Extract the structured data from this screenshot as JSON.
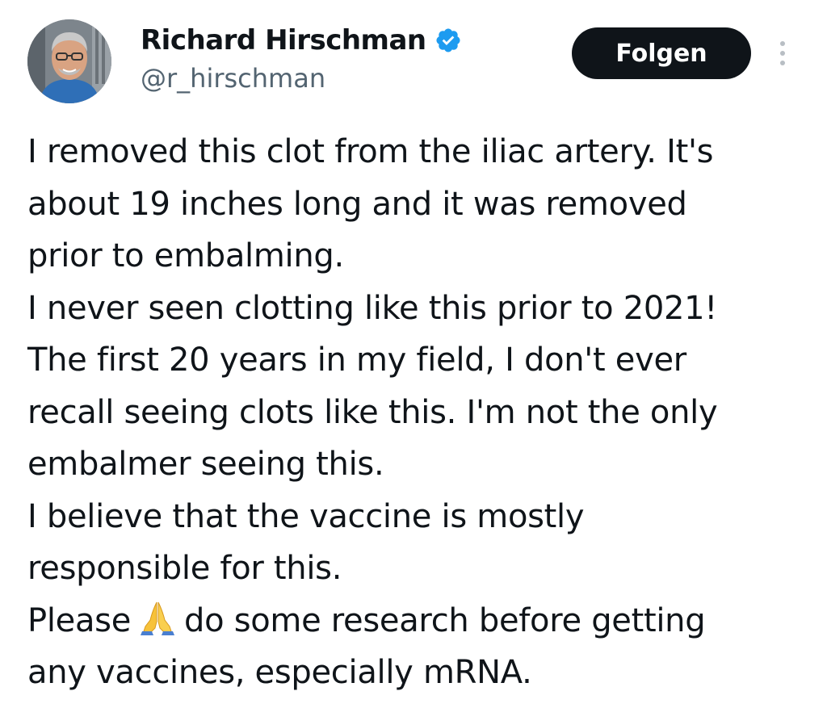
{
  "author": {
    "display_name": "Richard Hirschman",
    "handle": "@r_hirschman",
    "verified": true,
    "verified_color": "#1d9bf0"
  },
  "actions": {
    "follow_label": "Folgen",
    "more_icon": "more-vertical-icon"
  },
  "tweet": {
    "lines": [
      "I removed this clot from the iliac artery. It's",
      "about 19 inches long and it was removed",
      "prior to embalming.",
      "I never seen clotting like this prior to 2021!",
      "The first 20 years in my field, I don't ever",
      "recall seeing clots like this. I'm not the only",
      "embalmer seeing this.",
      "I believe that the vaccine is mostly",
      "responsible for this.",
      "Please",
      "do some research before getting",
      "any vaccines, especially mRNA."
    ],
    "emoji": "folded-hands-emoji"
  },
  "colors": {
    "text": "#0f1419",
    "secondary": "#536471",
    "button_bg": "#0f1419",
    "button_text": "#ffffff"
  }
}
